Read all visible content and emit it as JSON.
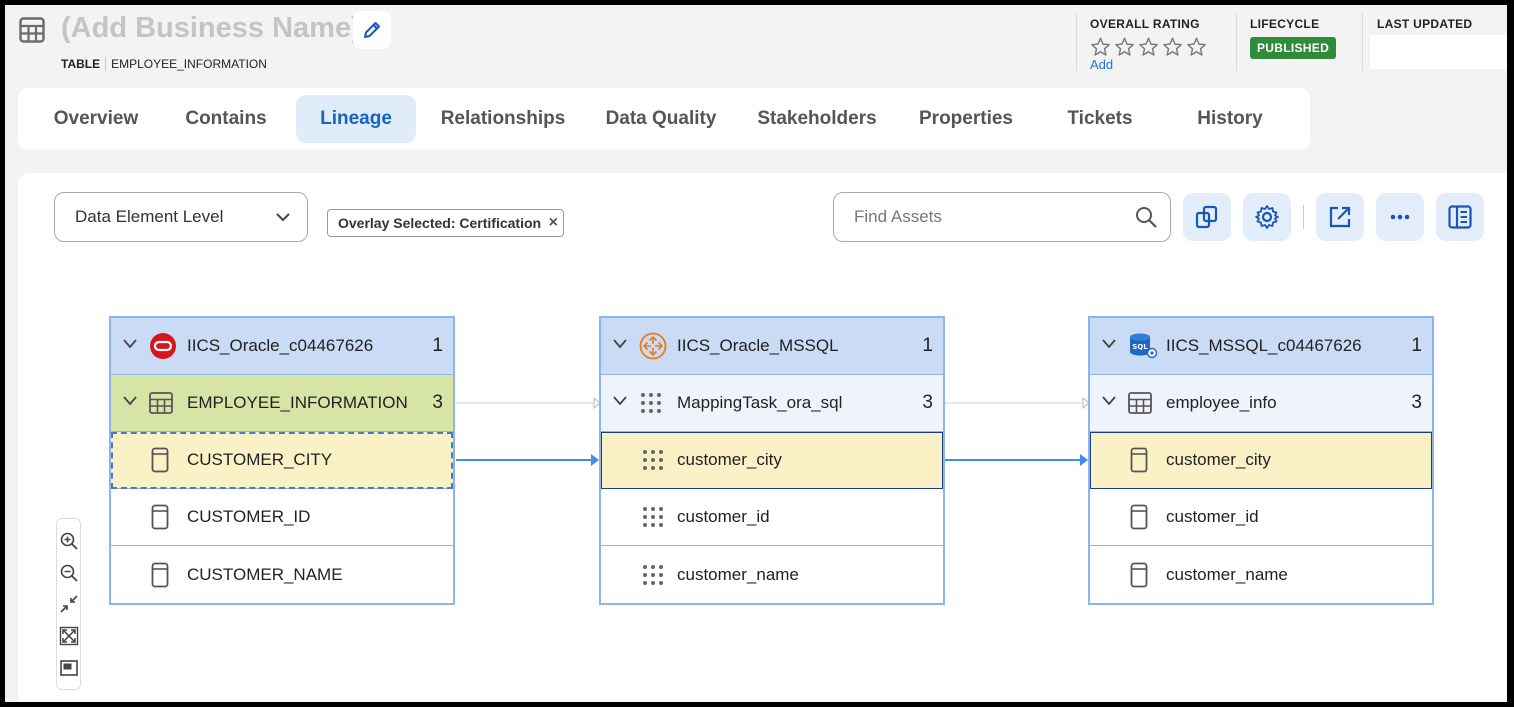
{
  "header": {
    "business_name": "(Add Business Name)",
    "asset_type": "TABLE",
    "asset_name": "EMPLOYEE_INFORMATION",
    "overall_rating_label": "OVERALL RATING",
    "rating_stars": 0,
    "rating_add_link": "Add",
    "lifecycle_label": "LIFECYCLE",
    "lifecycle_status": "PUBLISHED",
    "last_updated_label": "LAST UPDATED",
    "last_updated_value": ""
  },
  "tabs": [
    {
      "label": "Overview"
    },
    {
      "label": "Contains"
    },
    {
      "label": "Lineage",
      "active": true
    },
    {
      "label": "Relationships"
    },
    {
      "label": "Data Quality"
    },
    {
      "label": "Stakeholders"
    },
    {
      "label": "Properties"
    },
    {
      "label": "Tickets"
    },
    {
      "label": "History"
    }
  ],
  "toolbar": {
    "level_select_value": "Data Element Level",
    "overlay_chip": "Overlay Selected: Certification",
    "find_placeholder": "Find Assets"
  },
  "lineage": {
    "nodes": [
      {
        "system": "IICS_Oracle_c04467626",
        "system_count": "1",
        "system_icon": "oracle-icon",
        "object": "EMPLOYEE_INFORMATION",
        "object_count": "3",
        "object_icon": "table-icon",
        "fields": [
          "CUSTOMER_CITY",
          "CUSTOMER_ID",
          "CUSTOMER_NAME"
        ],
        "field_icon": "column-icon"
      },
      {
        "system": "IICS_Oracle_MSSQL",
        "system_count": "1",
        "system_icon": "integration-icon",
        "object": "MappingTask_ora_sql",
        "object_count": "3",
        "object_icon": "mapping-task-icon",
        "fields": [
          "customer_city",
          "customer_id",
          "customer_name"
        ],
        "field_icon": "dots-grid-icon"
      },
      {
        "system": "IICS_MSSQL_c04467626",
        "system_count": "1",
        "system_icon": "sql-server-icon",
        "object": "employee_info",
        "object_count": "3",
        "object_icon": "table-icon",
        "fields": [
          "customer_city",
          "customer_id",
          "customer_name"
        ],
        "field_icon": "column-icon"
      }
    ]
  },
  "colors": {
    "accent": "#1565c0",
    "published": "#2e8b3a",
    "node_header": "#c9dbf5",
    "selected_field": "#faf2c6",
    "source_object": "#d6e4a5",
    "edge": "#3d8ee8"
  }
}
